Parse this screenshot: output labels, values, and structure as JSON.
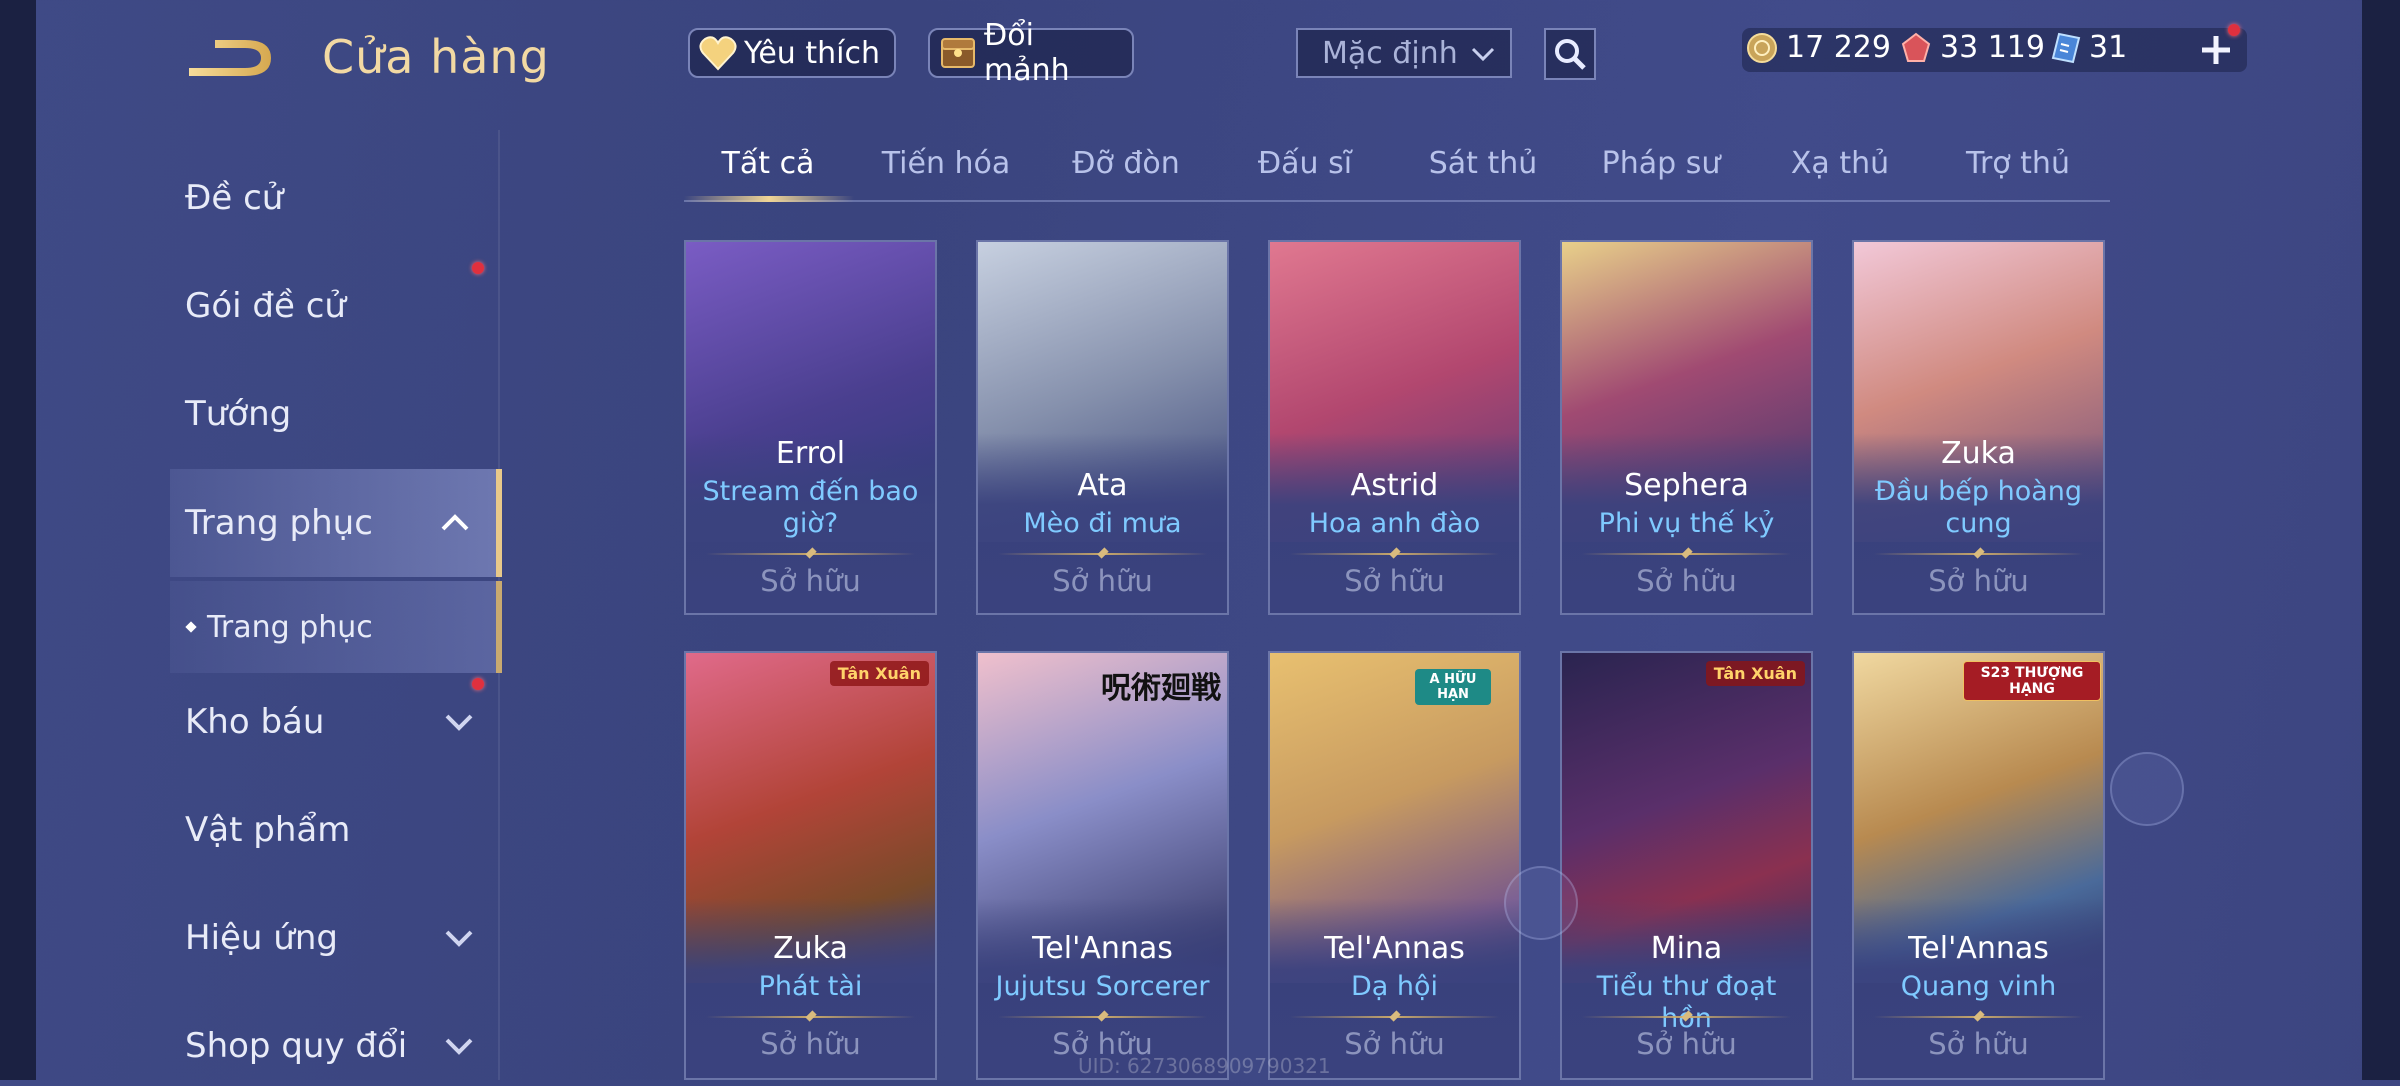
{
  "header": {
    "title": "Cửa hàng",
    "favorites_label": "Yêu thích",
    "shard_exchange_label": "Đổi mảnh",
    "sort_value": "Mặc định"
  },
  "currencies": {
    "gold": "17 229",
    "ruby": "33 119",
    "voucher": "31"
  },
  "sidebar": {
    "items": [
      {
        "label": "Đề cử"
      },
      {
        "label": "Gói đề cử"
      },
      {
        "label": "Tướng"
      },
      {
        "label": "Trang phục"
      },
      {
        "label": "Trang phục"
      },
      {
        "label": "Kho báu"
      },
      {
        "label": "Vật phẩm"
      },
      {
        "label": "Hiệu ứng"
      },
      {
        "label": "Shop quy đổi"
      }
    ]
  },
  "tabs": [
    "Tất cả",
    "Tiến hóa",
    "Đỡ đòn",
    "Đấu sĩ",
    "Sát thủ",
    "Pháp sư",
    "Xạ thủ",
    "Trợ thủ"
  ],
  "cards": [
    {
      "hero": "Errol",
      "skin_line1": "Stream đến bao",
      "skin_line2": "giờ?",
      "status": "Sở hữu",
      "art": "#5a4c9e"
    },
    {
      "hero": "Ata",
      "skin_line1": "Mèo đi mưa",
      "skin_line2": "",
      "status": "Sở hữu",
      "art": "#7c8aa4"
    },
    {
      "hero": "Astrid",
      "skin_line1": "Hoa anh đào",
      "skin_line2": "",
      "status": "Sở hữu",
      "art": "#b24a72"
    },
    {
      "hero": "Sephera",
      "skin_line1": "Phi vụ thế kỷ",
      "skin_line2": "",
      "status": "Sở hữu",
      "art": "#8a4a78"
    },
    {
      "hero": "Zuka",
      "skin_line1": "Đầu bếp hoàng",
      "skin_line2": "cung",
      "status": "Sở hữu",
      "art": "#c08a70"
    },
    {
      "hero": "Zuka",
      "skin_line1": "Phát tài",
      "skin_line2": "",
      "status": "Sở hữu",
      "art": "#a8403a",
      "badge": "Tân Xuân"
    },
    {
      "hero": "Tel'Annas",
      "skin_line1": "Jujutsu Sorcerer",
      "skin_line2": "",
      "status": "Sở hữu",
      "art": "#7f86b8",
      "badge": "呪術廻戦"
    },
    {
      "hero": "Tel'Annas",
      "skin_line1": "Dạ hội",
      "skin_line2": "",
      "status": "Sở hữu",
      "art": "#c79a60",
      "badge": "A HỮU HẠN"
    },
    {
      "hero": "Mina",
      "skin_line1": "Tiểu thư đoạt hồn",
      "skin_line2": "",
      "status": "Sở hữu",
      "art": "#3a2f5e",
      "badge": "Tân Xuân"
    },
    {
      "hero": "Tel'Annas",
      "skin_line1": "Quang vinh",
      "skin_line2": "",
      "status": "Sở hữu",
      "art": "#b88a50",
      "badge": "S23 THƯỢNG HẠNG"
    }
  ],
  "footer": {
    "uid": "UID: 6273068909790321"
  }
}
